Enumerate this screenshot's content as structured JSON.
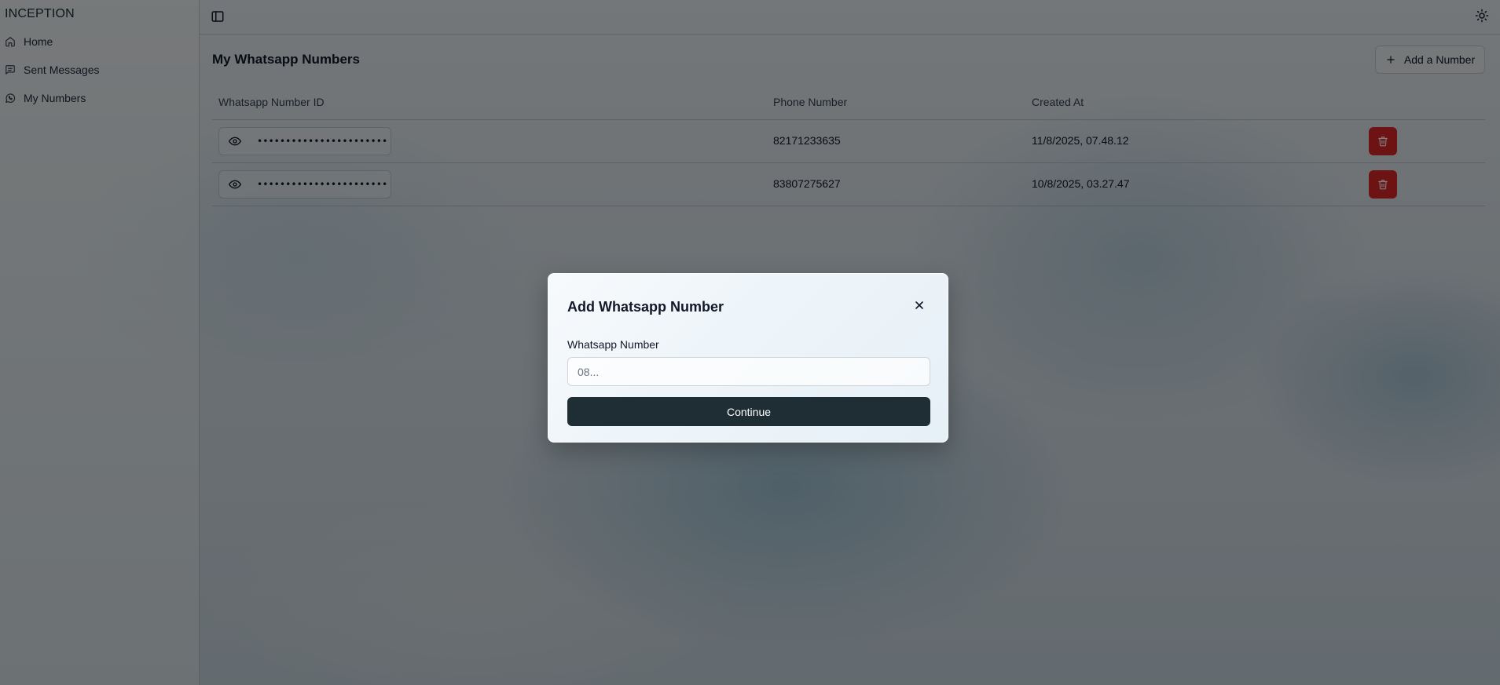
{
  "sidebar": {
    "brand": "INCEPTION",
    "items": [
      {
        "label": "Home",
        "icon": "home-icon"
      },
      {
        "label": "Sent Messages",
        "icon": "message-square-icon"
      },
      {
        "label": "My Numbers",
        "icon": "whatsapp-icon"
      }
    ]
  },
  "topbar": {
    "toggle_icon": "sidebar-toggle-icon",
    "theme_icon": "sun-icon"
  },
  "main": {
    "title": "My Whatsapp Numbers",
    "add_button_label": "Add a Number",
    "table": {
      "columns": [
        "Whatsapp Number ID",
        "Phone Number",
        "Created At"
      ],
      "rows": [
        {
          "masked_id": "•••••••••••••••••••••••",
          "phone": "82171233635",
          "created_at": "11/8/2025, 07.48.12"
        },
        {
          "masked_id": "•••••••••••••••••••••••",
          "phone": "83807275627",
          "created_at": "10/8/2025, 03.27.47"
        }
      ]
    }
  },
  "modal": {
    "title": "Add Whatsapp Number",
    "field_label": "Whatsapp Number",
    "field_placeholder": "08...",
    "field_value": "",
    "submit_label": "Continue"
  },
  "colors": {
    "delete_button": "#dc2626",
    "continue_button": "#1f2d35",
    "overlay": "rgba(0,0,0,0.5)"
  }
}
